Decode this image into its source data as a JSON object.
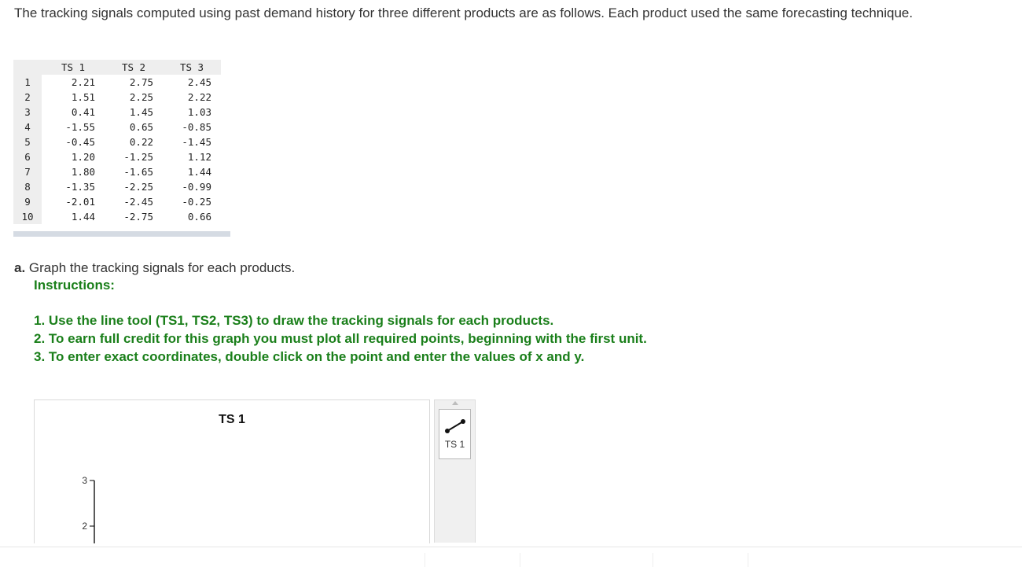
{
  "intro_text": "The tracking signals computed using past demand history for three different products are as follows. Each product used the same forecasting technique.",
  "table": {
    "headers": [
      "",
      "TS 1",
      "TS 2",
      "TS 3"
    ],
    "rows": [
      [
        "1",
        "2.21",
        "2.75",
        "2.45"
      ],
      [
        "2",
        "1.51",
        "2.25",
        "2.22"
      ],
      [
        "3",
        "0.41",
        "1.45",
        "1.03"
      ],
      [
        "4",
        "-1.55",
        "0.65",
        "-0.85"
      ],
      [
        "5",
        "-0.45",
        "0.22",
        "-1.45"
      ],
      [
        "6",
        "1.20",
        "-1.25",
        "1.12"
      ],
      [
        "7",
        "1.80",
        "-1.65",
        "1.44"
      ],
      [
        "8",
        "-1.35",
        "-2.25",
        "-0.99"
      ],
      [
        "9",
        "-2.01",
        "-2.45",
        "-0.25"
      ],
      [
        "10",
        "1.44",
        "-2.75",
        "0.66"
      ]
    ]
  },
  "question": {
    "letter": "a.",
    "text": " Graph the tracking signals for each products."
  },
  "instructions": {
    "heading": "Instructions:",
    "items": [
      "1. Use the line tool (TS1, TS2, TS3) to draw the tracking signals for each products.",
      "2. To earn full credit for this graph you must plot all required points, beginning with the first unit.",
      "3. To enter exact coordinates, double click on the point and enter the values of x and y."
    ]
  },
  "graph": {
    "title": "TS 1",
    "y_ticks": [
      "3",
      "2"
    ]
  },
  "tool": {
    "label": "TS 1",
    "icon": "line-tool-icon"
  },
  "colors": {
    "instruction_green": "#1a7f1a",
    "table_header_bg": "#eeeeee",
    "tool_panel_bg": "#f0f0f0"
  }
}
